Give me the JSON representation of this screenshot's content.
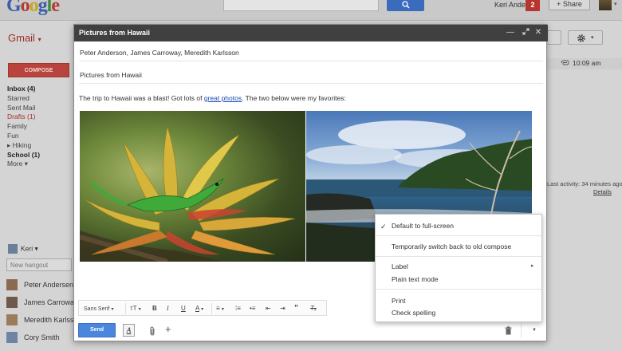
{
  "header": {
    "logo": "Google",
    "user_name": "Keri Anderson",
    "notification_count": "2",
    "share_label": "+ Share"
  },
  "gmail": {
    "label": "Gmail",
    "compose_label": "COMPOSE",
    "nav": [
      {
        "label": "Inbox (4)",
        "bold": true
      },
      {
        "label": "Starred"
      },
      {
        "label": "Sent Mail"
      },
      {
        "label": "Drafts (1)",
        "red": true
      },
      {
        "label": "Family"
      },
      {
        "label": "Fun"
      },
      {
        "label": "▸ Hiking"
      },
      {
        "label": "School (1)",
        "bold": true
      },
      {
        "label": "More ▾"
      }
    ],
    "time": "10:09 am",
    "activity": "Last activity: 34 minutes ago",
    "details": "Details"
  },
  "chat": {
    "user": "Keri",
    "new_hangout_placeholder": "New hangout",
    "contacts": [
      {
        "name": "Peter Andersen",
        "color": "#8a6a52"
      },
      {
        "name": "James Carroway",
        "color": "#6d5a4a"
      },
      {
        "name": "Meredith Karlsson",
        "color": "#9c7b5c"
      },
      {
        "name": "Cory Smith",
        "color": "#6f84a3"
      }
    ]
  },
  "compose": {
    "title": "Pictures from Hawaii",
    "recipients": "Peter Anderson, James Carroway, Meredith Karlsson",
    "subject": "Pictures from Hawaii",
    "body_before": "The trip to Hawaii was a blast!  Got lots of ",
    "body_link": "great photos",
    "body_after": ".  The two below were my favorites:",
    "send_label": "Send",
    "font_label": "Sans Serif"
  },
  "menu": {
    "items": [
      {
        "label": "Default to full-screen",
        "checked": true
      },
      {
        "label": "Temporarily switch back to old compose"
      },
      {
        "label": "Label",
        "submenu": true
      },
      {
        "label": "Plain text mode"
      },
      {
        "label": "Print"
      },
      {
        "label": "Check spelling"
      }
    ]
  },
  "colors": {
    "compose_header": "#404040",
    "send_button": "#4a86dd",
    "compose_button": "#b8443d",
    "link": "#1a48b2"
  }
}
